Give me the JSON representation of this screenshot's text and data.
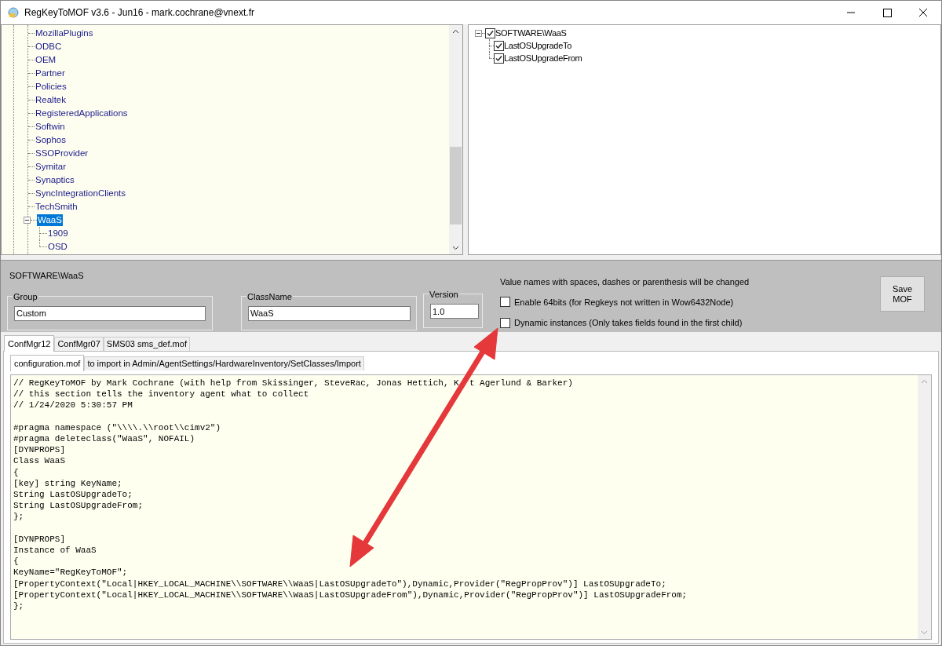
{
  "window": {
    "title": "RegKeyToMOF v3.6 - Jun16 - mark.cochrane@vnext.fr"
  },
  "registry_tree": {
    "items": [
      {
        "label": "MozillaPlugins",
        "selected": false
      },
      {
        "label": "ODBC",
        "selected": false
      },
      {
        "label": "OEM",
        "selected": false
      },
      {
        "label": "Partner",
        "selected": false
      },
      {
        "label": "Policies",
        "selected": false
      },
      {
        "label": "Realtek",
        "selected": false
      },
      {
        "label": "RegisteredApplications",
        "selected": false
      },
      {
        "label": "Softwin",
        "selected": false
      },
      {
        "label": "Sophos",
        "selected": false
      },
      {
        "label": "SSOProvider",
        "selected": false
      },
      {
        "label": "Symitar",
        "selected": false
      },
      {
        "label": "Synaptics",
        "selected": false
      },
      {
        "label": "SyncIntegrationClients",
        "selected": false
      },
      {
        "label": "TechSmith",
        "selected": false
      },
      {
        "label": "WaaS",
        "selected": true,
        "expanded": true,
        "children": [
          {
            "label": "1909",
            "selected": false
          },
          {
            "label": "OSD",
            "selected": false
          }
        ]
      }
    ]
  },
  "values_tree": {
    "label": "SOFTWARE\\WaaS",
    "checked": true,
    "expanded": true,
    "children": [
      {
        "label": "LastOSUpgradeTo",
        "checked": true
      },
      {
        "label": "LastOSUpgradeFrom",
        "checked": true
      }
    ]
  },
  "settings": {
    "key_path": "SOFTWARE\\WaaS",
    "group": {
      "label": "Group",
      "value": "Custom"
    },
    "class_name": {
      "label": "ClassName",
      "value": "WaaS"
    },
    "version": {
      "label": "Version",
      "value": "1.0"
    },
    "notice": "Value names with spaces, dashes or parenthesis will be changed",
    "options": [
      {
        "label": "Enable 64bits (for Regkeys not written in Wow6432Node)",
        "checked": false
      },
      {
        "label": "Dynamic instances (Only takes fields found in the first child)",
        "checked": false
      }
    ],
    "save_button": "Save\nMOF"
  },
  "tabs": [
    {
      "label": "ConfMgr12",
      "selected": true
    },
    {
      "label": "ConfMgr07",
      "selected": false
    },
    {
      "label": "SMS03 sms_def.mof",
      "selected": false
    }
  ],
  "sub_tabs": [
    {
      "label": "configuration.mof",
      "selected": true
    },
    {
      "label": "to import in Admin/AgentSettings/HardwareInventory/SetClasses/Import",
      "selected": false
    }
  ],
  "code_blocks": [
    [
      [
        "// RegKeyToMOF by Mark Cochrane (with help from Skissinger, SteveRac, Jonas Hettich, K",
        "t Agerlund & Barker)"
      ],
      "// this section tells the inventory agent what to collect",
      "// 1/24/2020 5:30:57 PM"
    ],
    [
      "#pragma namespace (\"\\\\\\\\.\\\\root\\\\cimv2\")",
      "#pragma deleteclass(\"WaaS\", NOFAIL)",
      "[DYNPROPS]",
      "Class WaaS",
      "{",
      "[key] string KeyName;",
      "String LastOSUpgradeTo;",
      "String LastOSUpgradeFrom;",
      "};"
    ],
    [
      "[DYNPROPS]",
      "Instance of WaaS",
      "{",
      "KeyName=\"RegKeyToMOF\";",
      "[PropertyContext(\"Local|HKEY_LOCAL_MACHINE\\\\SOFTWARE\\\\WaaS|LastOSUpgradeTo\"),Dynamic,Provider(\"RegPropProv\")] LastOSUpgradeTo;",
      "[PropertyContext(\"Local|HKEY_LOCAL_MACHINE\\\\SOFTWARE\\\\WaaS|LastOSUpgradeFrom\"),Dynamic,Provider(\"RegPropProv\")] LastOSUpgradeFrom;",
      "};"
    ]
  ]
}
